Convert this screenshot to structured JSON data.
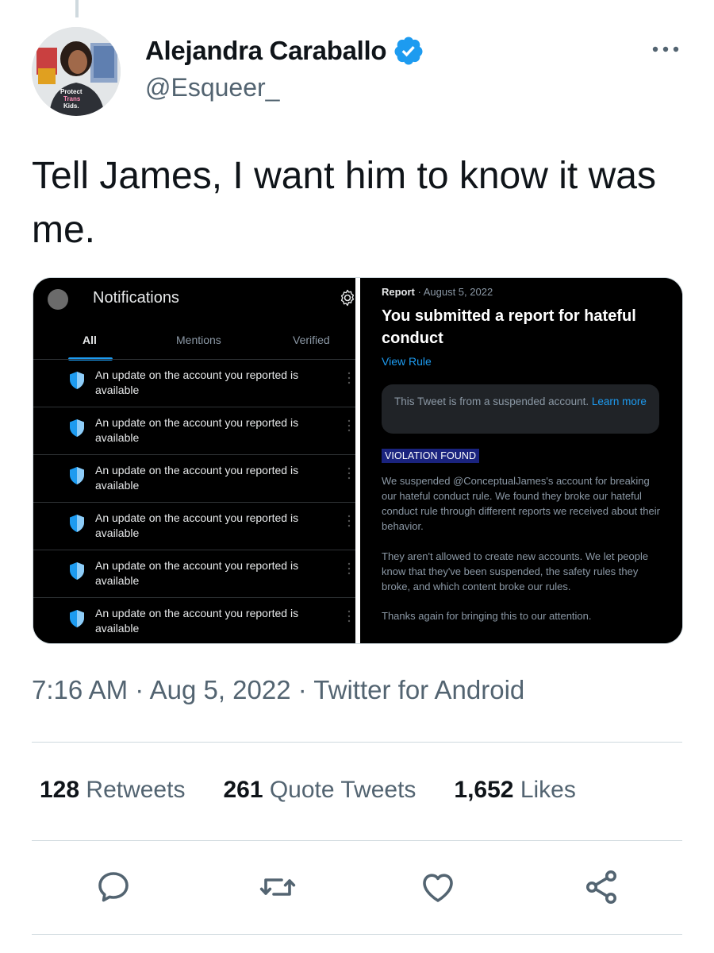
{
  "author": {
    "display_name": "Alejandra Caraballo",
    "handle": "@Esqueer_",
    "verified": true,
    "avatar_shirt_text": "Protect Trans Kids."
  },
  "tweet": {
    "text": "Tell James, I want him to know it was me.",
    "timestamp": "7:16 AM · Aug 5, 2022 · Twitter for Android"
  },
  "media": {
    "notifications": {
      "title": "Notifications",
      "tabs": [
        {
          "label": "All",
          "active": true
        },
        {
          "label": "Mentions",
          "active": false
        },
        {
          "label": "Verified",
          "active": false
        }
      ],
      "items": [
        {
          "text": "An update on the account you reported is available"
        },
        {
          "text": "An update on the account you reported is available"
        },
        {
          "text": "An update on the account you reported is available"
        },
        {
          "text": "An update on the account you reported is available"
        },
        {
          "text": "An update on the account you reported is available"
        },
        {
          "text": "An update on the account you reported is available"
        }
      ]
    },
    "report": {
      "label": "Report",
      "date": " · August 5, 2022",
      "title": "You submitted a report for hateful conduct",
      "view_rule": "View Rule",
      "suspended_notice": "This Tweet is from a suspended account. ",
      "learn_more": "Learn more",
      "violation_badge": "VIOLATION FOUND",
      "paragraphs": [
        "We suspended @ConceptualJames's account for breaking our hateful conduct rule. We found they broke our hateful conduct rule through different reports we received about their behavior.",
        "They aren't allowed to create new accounts. We let people know that they've been suspended, the safety rules they broke, and which content broke our rules.",
        "Thanks again for bringing this to our attention."
      ]
    }
  },
  "stats": {
    "retweets_count": "128",
    "retweets_label": " Retweets",
    "quotes_count": "261",
    "quotes_label": " Quote Tweets",
    "likes_count": "1,652",
    "likes_label": " Likes"
  },
  "icons": {
    "verified": "verified-badge-icon",
    "more": "more-icon",
    "reply": "reply-icon",
    "retweet": "retweet-icon",
    "like": "like-icon",
    "share": "share-icon",
    "gear": "gear-icon",
    "shield": "shield-icon"
  },
  "colors": {
    "accent": "#1d9bf0",
    "text_primary": "#0f1419",
    "text_secondary": "#536471",
    "violation_badge_bg": "#1a237e"
  }
}
